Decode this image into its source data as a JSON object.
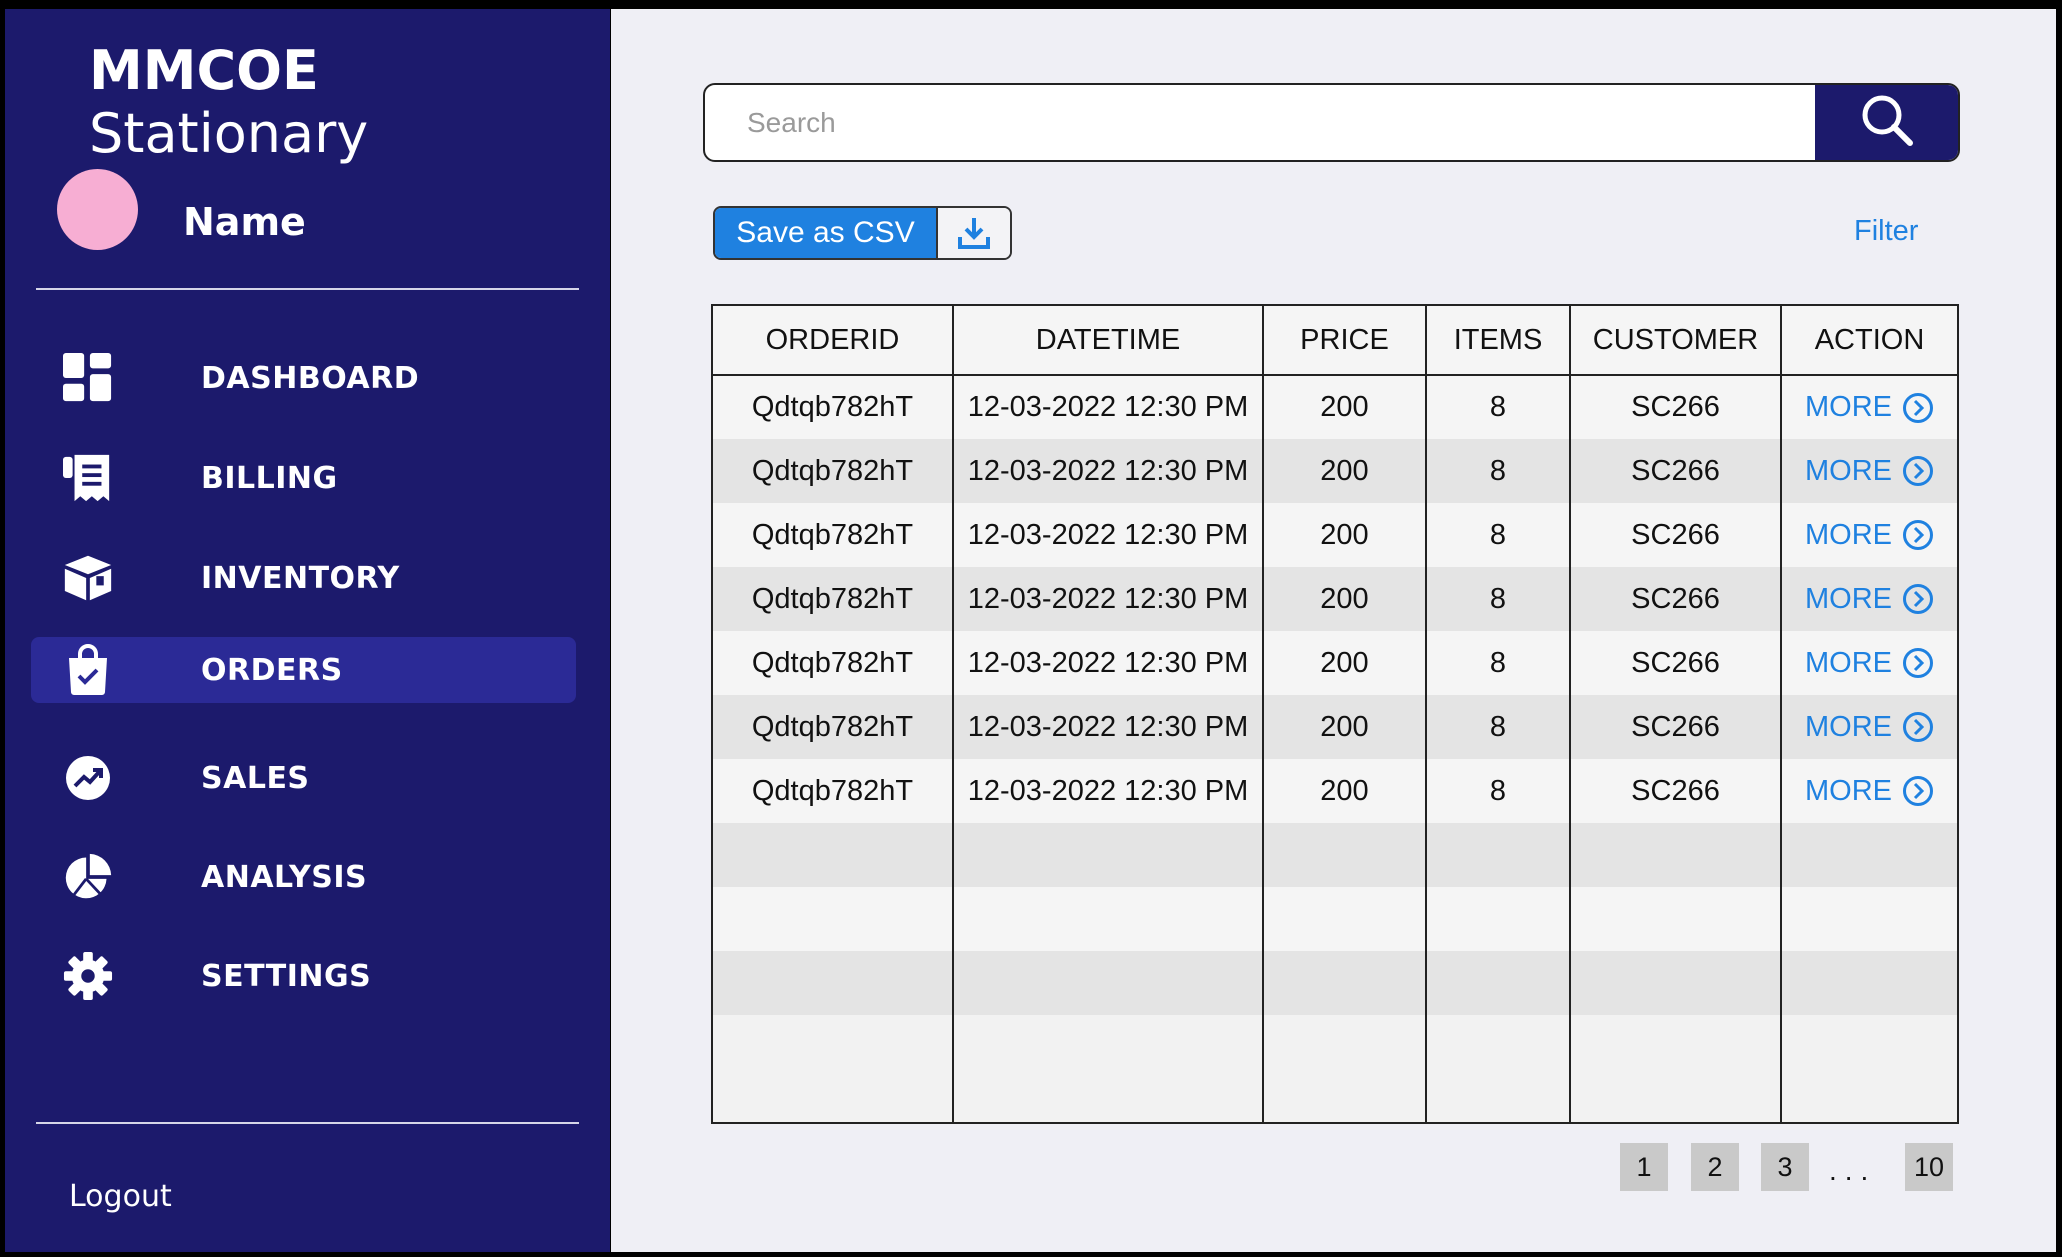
{
  "app": {
    "title_bold": "MMCOE",
    "title_rest": " Stationary"
  },
  "user": {
    "name": "Name",
    "avatar_color": "#f7aed3"
  },
  "sidebar": {
    "items": [
      {
        "label": "DASHBOARD",
        "icon": "dashboard-icon",
        "active": false
      },
      {
        "label": "BILLING",
        "icon": "receipt-icon",
        "active": false
      },
      {
        "label": "INVENTORY",
        "icon": "box-icon",
        "active": false
      },
      {
        "label": "ORDERS",
        "icon": "shopping-bag-icon",
        "active": true
      },
      {
        "label": "SALES",
        "icon": "trending-up-icon",
        "active": false
      },
      {
        "label": "ANALYSIS",
        "icon": "pie-chart-icon",
        "active": false
      },
      {
        "label": "SETTINGS",
        "icon": "gear-icon",
        "active": false
      }
    ],
    "logout": "Logout"
  },
  "search": {
    "placeholder": "Search",
    "value": ""
  },
  "toolbar": {
    "save_csv": "Save as CSV",
    "filter": "Filter"
  },
  "table": {
    "columns": [
      "ORDERID",
      "DATETIME",
      "PRICE",
      "ITEMS",
      "CUSTOMER",
      "ACTION"
    ],
    "rows": [
      {
        "orderid": "Qdtqb782hT",
        "datetime": "12-03-2022 12:30 PM",
        "price": "200",
        "items": "8",
        "customer": "SC266",
        "action": "MORE"
      },
      {
        "orderid": "Qdtqb782hT",
        "datetime": "12-03-2022 12:30 PM",
        "price": "200",
        "items": "8",
        "customer": "SC266",
        "action": "MORE"
      },
      {
        "orderid": "Qdtqb782hT",
        "datetime": "12-03-2022 12:30 PM",
        "price": "200",
        "items": "8",
        "customer": "SC266",
        "action": "MORE"
      },
      {
        "orderid": "Qdtqb782hT",
        "datetime": "12-03-2022 12:30 PM",
        "price": "200",
        "items": "8",
        "customer": "SC266",
        "action": "MORE"
      },
      {
        "orderid": "Qdtqb782hT",
        "datetime": "12-03-2022 12:30 PM",
        "price": "200",
        "items": "8",
        "customer": "SC266",
        "action": "MORE"
      },
      {
        "orderid": "Qdtqb782hT",
        "datetime": "12-03-2022 12:30 PM",
        "price": "200",
        "items": "8",
        "customer": "SC266",
        "action": "MORE"
      },
      {
        "orderid": "Qdtqb782hT",
        "datetime": "12-03-2022 12:30 PM",
        "price": "200",
        "items": "8",
        "customer": "SC266",
        "action": "MORE"
      }
    ]
  },
  "pagination": {
    "pages": [
      "1",
      "2",
      "3"
    ],
    "ellipsis": "...",
    "last": "10"
  },
  "colors": {
    "sidebar_bg": "#1c1a6c",
    "active_bg": "#2b2a96",
    "accent": "#1f81e0",
    "main_bg": "#efeff5"
  }
}
